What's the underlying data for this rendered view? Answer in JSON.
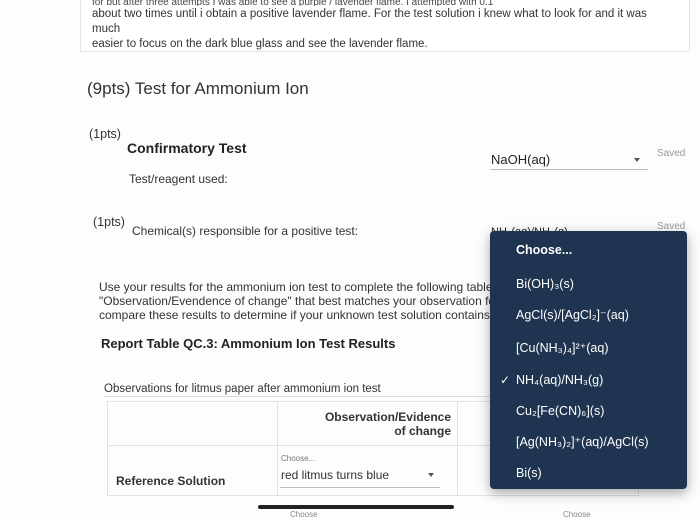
{
  "top_note": {
    "line0": "for but after three attempts I was able to see a purple / lavender flame. I attempted with 0.1",
    "line1": "about two times until i obtain a positive lavender flame. For the test solution i knew what to look for and it was much",
    "line2": "easier to focus on the dark blue glass and see the lavender flame."
  },
  "section": {
    "title": "(9pts) Test for Ammonium Ion"
  },
  "q1": {
    "points": "(1pts)",
    "heading": "Confirmatory Test",
    "label": "Test/reagent used:",
    "value": "NaOH(aq)",
    "status": "Saved"
  },
  "q2": {
    "points": "(1pts)",
    "label": "Chemical(s) responsible for a positive test:",
    "value": "NH₄(aq)/NH₃(g)",
    "status": "Saved"
  },
  "instructions": {
    "line1": "Use your results for the ammonium ion test to complete the following table. S",
    "line2": "\"Observation/Evendence of change\" that best matches your observation for e",
    "line3": "compare these results to determine if your unknown test solution contains an"
  },
  "report": {
    "title": "Report Table QC.3: Ammonium Ion Test Results",
    "obs_label": "Observations for litmus paper after ammonium ion test",
    "col_header": "Observation/Evidence of change",
    "row_label": "Reference Solution",
    "choose_small": "Choose...",
    "row_value": "red litmus turns blue",
    "cut_choose": "Choose"
  },
  "dropdown": {
    "options": [
      {
        "label": "Choose...",
        "selected": false
      },
      {
        "label": "Bi(OH)₃(s)",
        "selected": false
      },
      {
        "label": "AgCl(s)/[AgCl₂]⁻(aq)",
        "selected": false
      },
      {
        "label": "[Cu(NH₃)₄]²⁺(aq)",
        "selected": false
      },
      {
        "label": "NH₄(aq)/NH₃(g)",
        "selected": true
      },
      {
        "label": "Cu₂[Fe(CN)₆](s)",
        "selected": false
      },
      {
        "label": "[Ag(NH₃)₂]⁺(aq)/AgCl(s)",
        "selected": false
      },
      {
        "label": "Bi(s)",
        "selected": false
      }
    ],
    "check_glyph": "✓"
  },
  "colors": {
    "dropdown_bg": "#1f3450",
    "text": "#333333"
  }
}
